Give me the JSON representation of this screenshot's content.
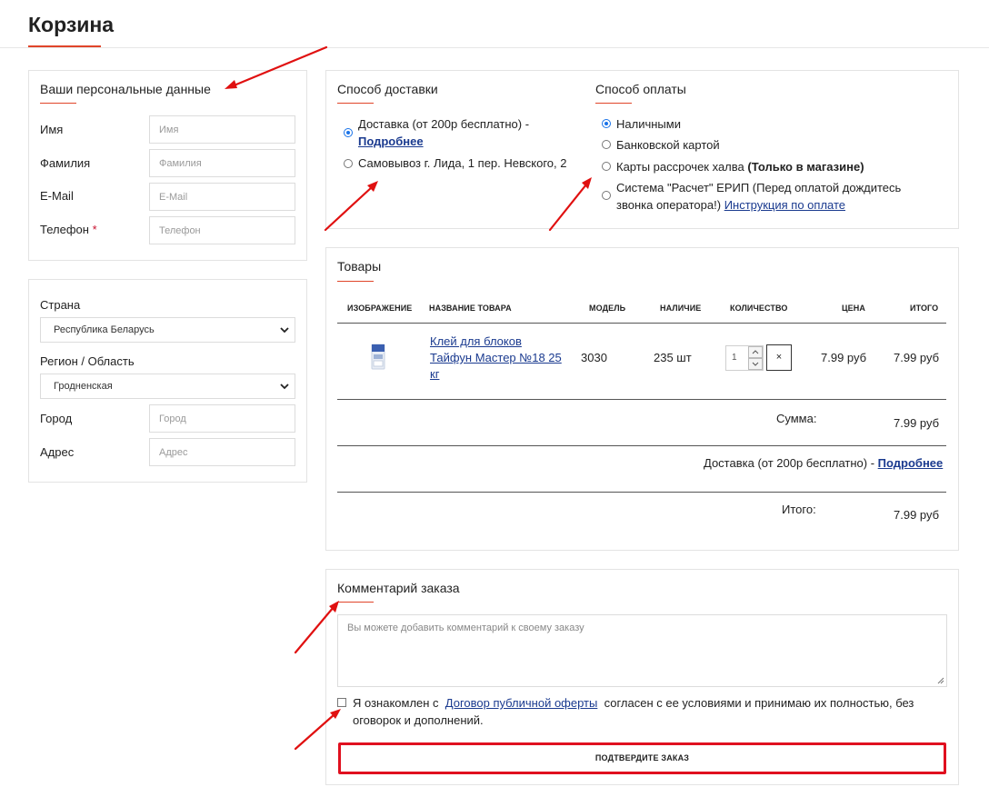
{
  "page": {
    "title": "Корзина"
  },
  "personal": {
    "title": "Ваши персональные данные",
    "fields": [
      {
        "label": "Имя",
        "placeholder": "Имя",
        "required": false
      },
      {
        "label": "Фамилия",
        "placeholder": "Фамилия",
        "required": false
      },
      {
        "label": "E-Mail",
        "placeholder": "E-Mail",
        "required": false
      },
      {
        "label": "Телефон",
        "placeholder": "Телефон",
        "required": true
      }
    ],
    "required_mark": "*"
  },
  "address": {
    "country_label": "Страна",
    "country_value": "Республика Беларусь",
    "region_label": "Регион / Область",
    "region_value": "Гродненская",
    "city_label": "Город",
    "city_placeholder": "Город",
    "addr_label": "Адрес",
    "addr_placeholder": "Адрес"
  },
  "delivery": {
    "title": "Способ доставки",
    "options": [
      {
        "text": "Доставка (от 200р бесплатно) -",
        "link": "Подробнее",
        "checked": true
      },
      {
        "text": "Самовывоз г. Лида, 1 пер. Невского, 2",
        "checked": false
      }
    ]
  },
  "payment": {
    "title": "Способ оплаты",
    "options": [
      {
        "text": "Наличными",
        "checked": true
      },
      {
        "text": "Банковской картой",
        "checked": false
      },
      {
        "text": "Карты рассрочек халва",
        "bold": "(Только в магазине)",
        "checked": false
      },
      {
        "text": "Система \"Расчет\" ЕРИП (Перед оплатой дождитесь",
        "text2": "звонка оператора!)",
        "link": "Инструкция по оплате",
        "checked": false
      }
    ]
  },
  "products": {
    "title": "Товары",
    "columns": [
      "ИЗОБРАЖЕНИЕ",
      "НАЗВАНИЕ ТОВАРА",
      "МОДЕЛЬ",
      "НАЛИЧИЕ",
      "КОЛИЧЕСТВО",
      "ЦЕНА",
      "ИТОГО"
    ],
    "rows": [
      {
        "name_line1": "Клей для блоков",
        "name_line2": "Тайфун Мастер №18 25",
        "name_line3": "кг",
        "model": "3030",
        "stock": "235 шт",
        "qty": "1",
        "remove": "×",
        "price": "7.99 руб",
        "total": "7.99 руб"
      }
    ],
    "sum_label": "Сумма:",
    "sum_value": "7.99 руб",
    "delivery_text": "Доставка (от 200р бесплатно) -",
    "delivery_link": "Подробнее",
    "total_label": "Итого:",
    "total_value": "7.99 руб"
  },
  "comment": {
    "title": "Комментарий заказа",
    "placeholder": "Вы можете добавить комментарий к своему заказу",
    "agree_pre": "Я ознакомлен с",
    "agree_link": "Договор публичной оферты",
    "agree_post": "согласен с ее условиями и принимаю их полностью, без",
    "agree_line2": "оговорок и дополнений.",
    "submit": "ПОДТВЕРДИТЕ ЗАКАЗ"
  },
  "colors": {
    "accent": "#e0452a",
    "link": "#1a3a8f",
    "radio": "#1a73e8",
    "annotation_arrow": "#e01010"
  }
}
